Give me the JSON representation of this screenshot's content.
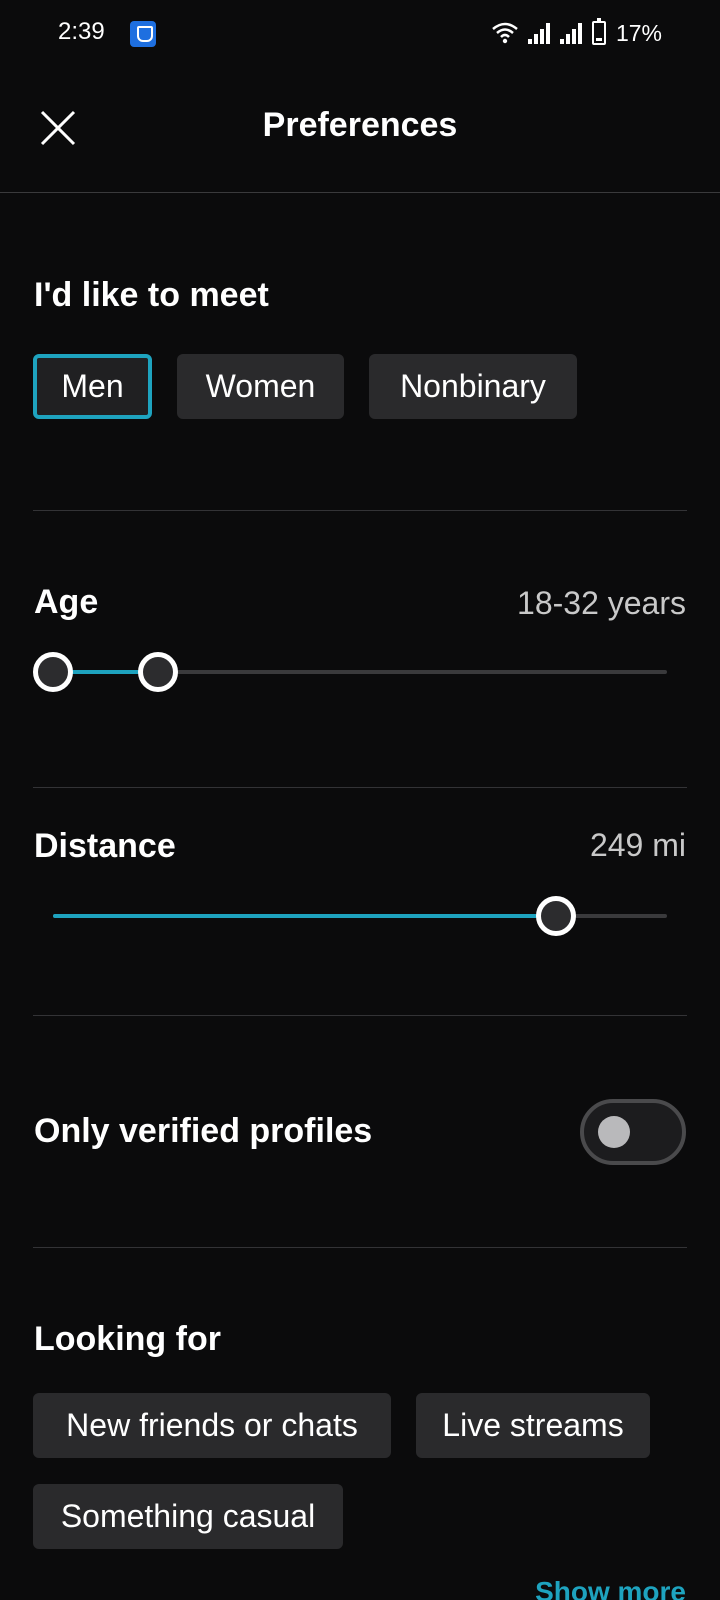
{
  "status_bar": {
    "time": "2:39",
    "battery_text": "17%"
  },
  "header": {
    "title": "Preferences"
  },
  "meet": {
    "title": "I'd like to meet",
    "options": [
      "Men",
      "Women",
      "Nonbinary"
    ],
    "selected": "Men"
  },
  "age": {
    "label": "Age",
    "value_text": "18-32 years",
    "min": 18,
    "max": 32
  },
  "distance": {
    "label": "Distance",
    "value_text": "249 mi",
    "value": 249
  },
  "verified": {
    "label": "Only verified profiles",
    "enabled": false
  },
  "looking_for": {
    "title": "Looking for",
    "options": [
      "New friends or chats",
      "Live streams",
      "Something casual"
    ]
  },
  "show_more_label": "Show more",
  "colors": {
    "accent": "#1ea3bf",
    "background": "#0b0b0c",
    "chip": "#2a2a2c"
  }
}
